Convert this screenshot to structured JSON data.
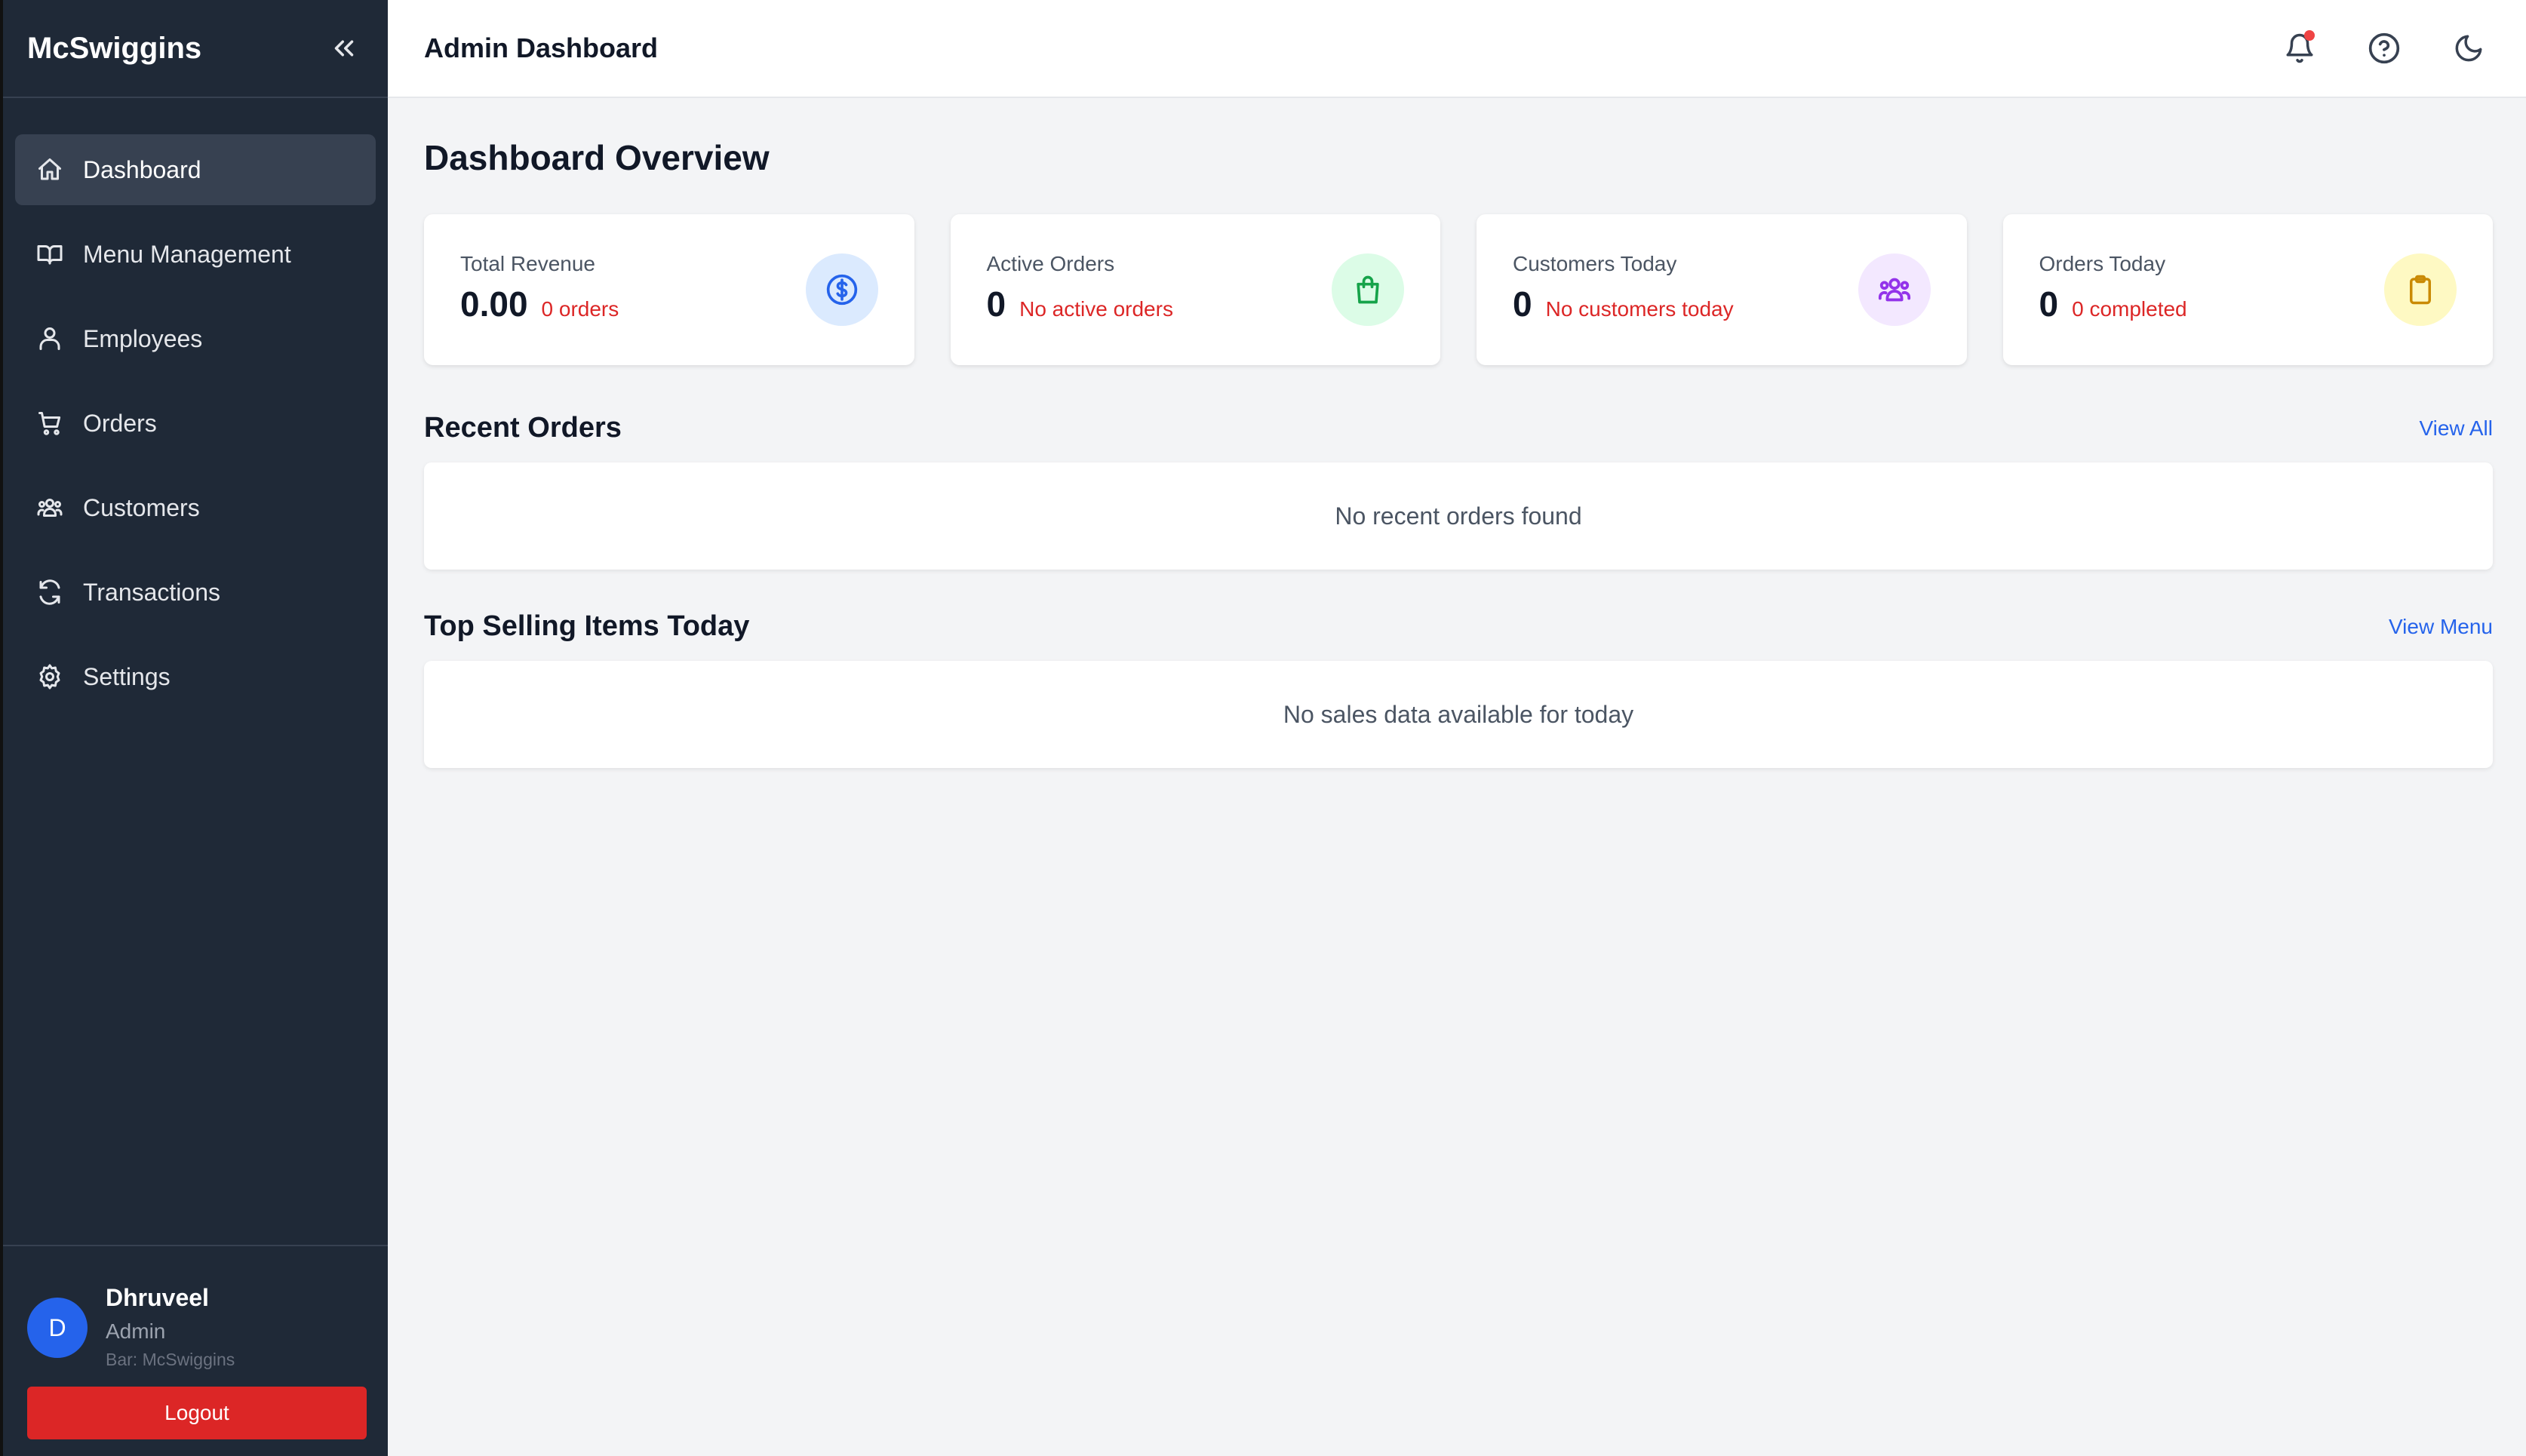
{
  "sidebar": {
    "brand": "McSwiggins",
    "items": [
      {
        "label": "Dashboard",
        "icon": "home-icon",
        "active": true
      },
      {
        "label": "Menu Management",
        "icon": "book-icon"
      },
      {
        "label": "Employees",
        "icon": "users-icon"
      },
      {
        "label": "Orders",
        "icon": "cart-icon"
      },
      {
        "label": "Customers",
        "icon": "user-group-icon"
      },
      {
        "label": "Transactions",
        "icon": "refresh-icon"
      },
      {
        "label": "Settings",
        "icon": "gear-icon"
      }
    ],
    "user": {
      "initial": "D",
      "name": "Dhruveel",
      "role": "Admin",
      "bar": "Bar: McSwiggins"
    },
    "logout_label": "Logout"
  },
  "topbar": {
    "title": "Admin Dashboard",
    "icons": [
      "bell-icon",
      "help-icon",
      "moon-icon"
    ]
  },
  "main": {
    "title": "Dashboard Overview",
    "cards": [
      {
        "label": "Total Revenue",
        "value": "0.00",
        "sub": "0 orders",
        "icon": "dollar-icon",
        "icon_bg": "#dbeafe",
        "icon_color": "#2563eb"
      },
      {
        "label": "Active Orders",
        "value": "0",
        "sub": "No active orders",
        "icon": "shopping-bag-icon",
        "icon_bg": "#dcfce7",
        "icon_color": "#16a34a"
      },
      {
        "label": "Customers Today",
        "value": "0",
        "sub": "No customers today",
        "icon": "user-group-icon",
        "icon_bg": "#f3e8ff",
        "icon_color": "#9333ea"
      },
      {
        "label": "Orders Today",
        "value": "0",
        "sub": "0 completed",
        "icon": "clipboard-icon",
        "icon_bg": "#fef9c3",
        "icon_color": "#ca8a04"
      }
    ],
    "recent_orders": {
      "title": "Recent Orders",
      "link": "View All",
      "empty": "No recent orders found"
    },
    "top_selling": {
      "title": "Top Selling Items Today",
      "link": "View Menu",
      "empty": "No sales data available for today"
    }
  },
  "colors": {
    "sidebar_bg": "#1f2937",
    "accent": "#2563eb",
    "danger": "#dc2626"
  }
}
